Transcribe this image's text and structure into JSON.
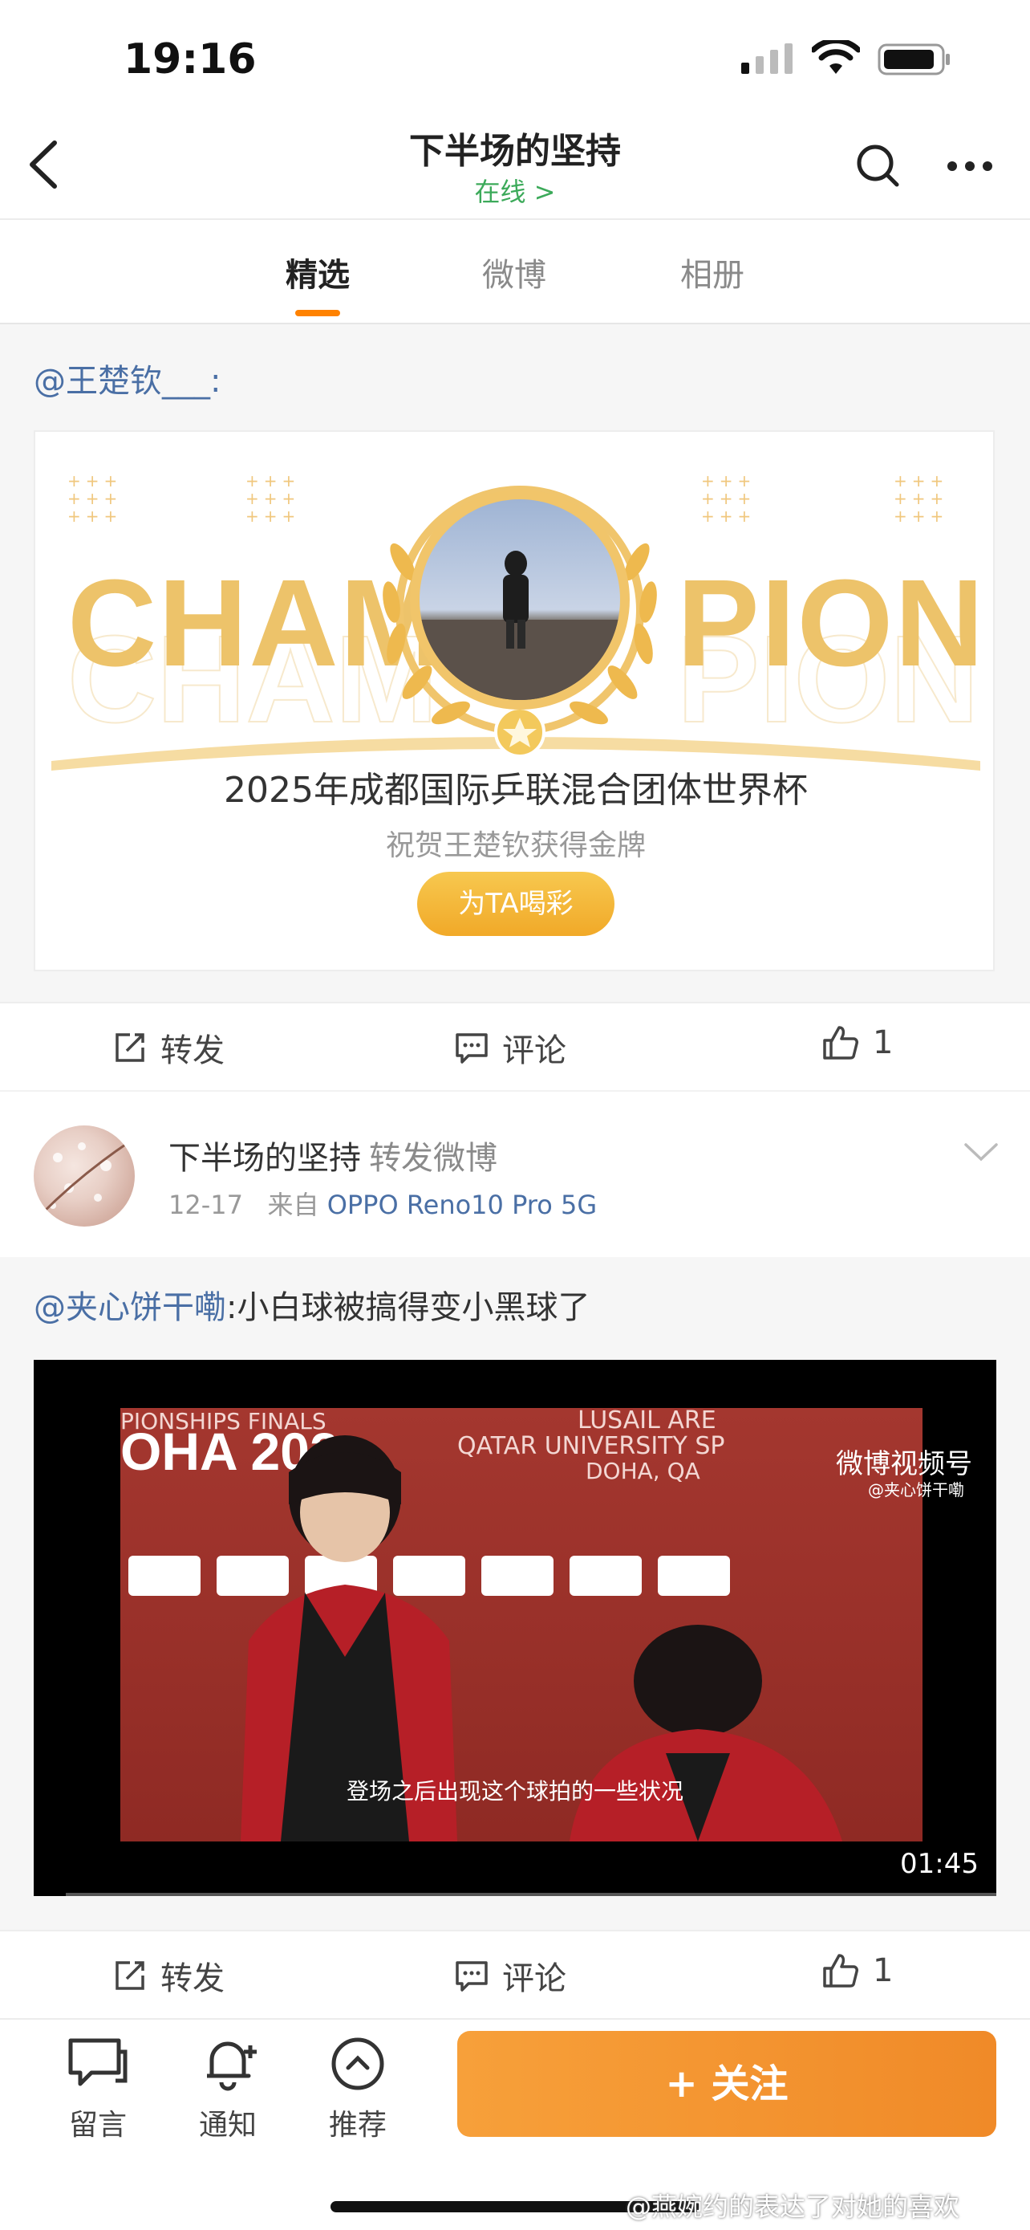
{
  "status": {
    "time": "19:16"
  },
  "nav": {
    "title": "下半场的坚持",
    "subtitle": "在线 >"
  },
  "tabs": [
    {
      "label": "精选",
      "active": true
    },
    {
      "label": "微博",
      "active": false
    },
    {
      "label": "相册",
      "active": false
    }
  ],
  "post1": {
    "mention": "@王楚钦___:",
    "card": {
      "champ_left": "CHAM",
      "champ_right": "PION",
      "title": "2025年成都国际乒联混合团体世界杯",
      "subtitle": "祝贺王楚钦获得金牌",
      "button": "为TA喝彩"
    },
    "actions": {
      "repost": "转发",
      "comment": "评论",
      "like_count": "1"
    }
  },
  "post2": {
    "author": "下半场的坚持",
    "action": "转发微博",
    "date": "12-17",
    "source_prefix": "来自",
    "device": "OPPO Reno10 Pro 5G",
    "mention": "@夹心饼干嘞",
    "text": ":小白球被搞得变小黑球了",
    "video": {
      "watermark": "微博视频号",
      "watermark_sub": "@夹心饼干嘞",
      "subtitle": "登场之后出现这个球拍的一些状况",
      "duration": "01:45",
      "board_left": "PIONSHIPS FINALS",
      "board_doha": "OHA 202",
      "board_right1": "LUSAIL ARE",
      "board_right2": "QATAR UNIVERSITY SP",
      "board_right3": "DOHA, QA"
    },
    "actions": {
      "repost": "转发",
      "comment": "评论",
      "like_count": "1"
    }
  },
  "bottom": {
    "message": "留言",
    "notify": "通知",
    "recommend": "推荐",
    "follow": "+ 关注"
  },
  "watermark": "@燕婉约的表达了对她的喜欢",
  "colors": {
    "accent": "#ff8200",
    "link": "#4a6fa5",
    "online": "#3caa5a",
    "follow": "#f39230"
  }
}
